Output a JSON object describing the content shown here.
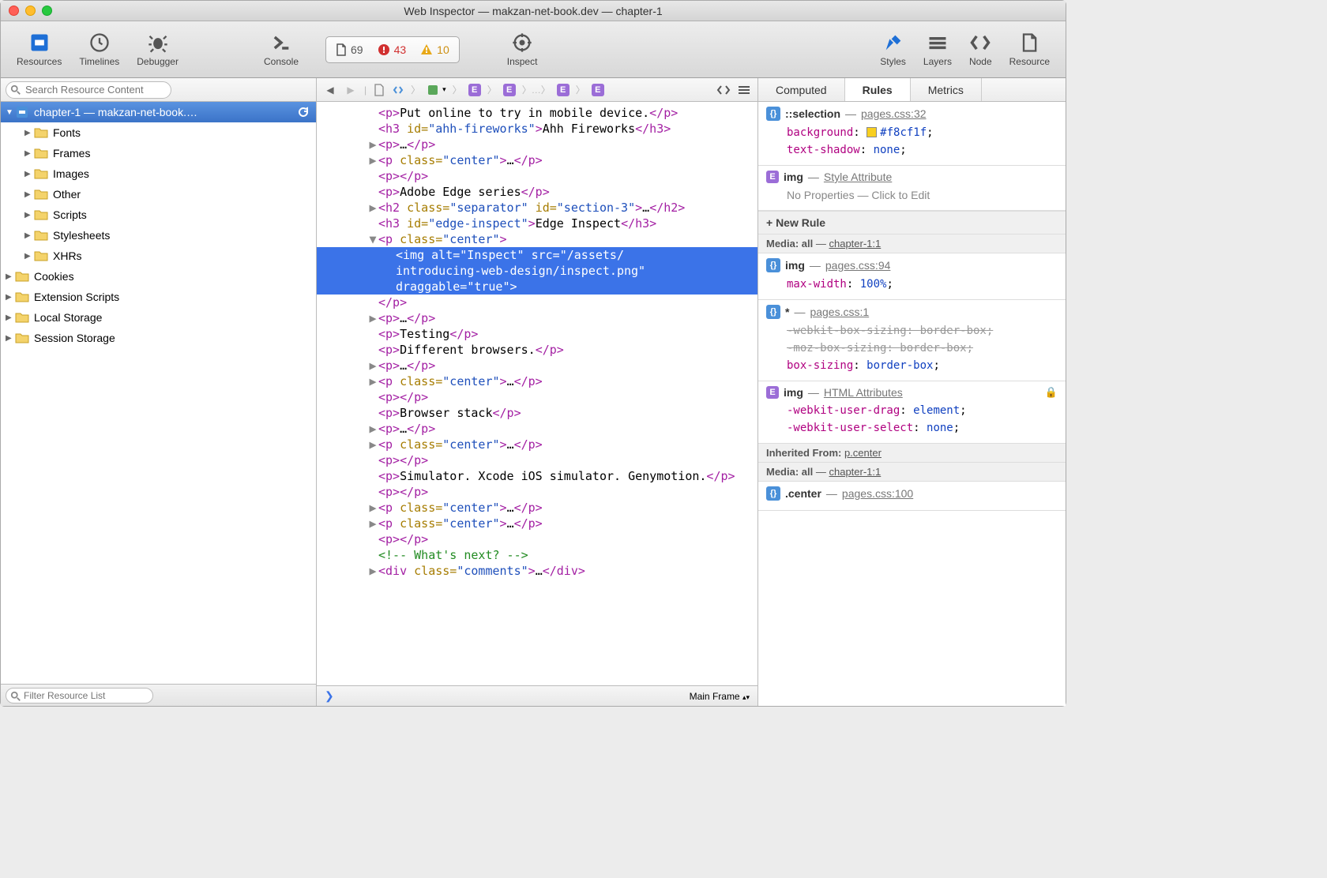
{
  "window": {
    "title": "Web Inspector — makzan-net-book.dev — chapter-1"
  },
  "toolbar": {
    "items": [
      {
        "label": "Resources"
      },
      {
        "label": "Timelines"
      },
      {
        "label": "Debugger"
      },
      {
        "label": "Console"
      },
      {
        "label": "Inspect"
      },
      {
        "label": "Styles"
      },
      {
        "label": "Layers"
      },
      {
        "label": "Node"
      },
      {
        "label": "Resource"
      }
    ],
    "status": {
      "resources": "69",
      "errors": "43",
      "warnings": "10"
    }
  },
  "sidebar": {
    "search_placeholder": "Search Resource Content",
    "filter_placeholder": "Filter Resource List",
    "root": "chapter-1 — makzan-net-book.…",
    "folders": [
      "Fonts",
      "Frames",
      "Images",
      "Other",
      "Scripts",
      "Stylesheets",
      "XHRs"
    ],
    "top": [
      "Cookies",
      "Extension Scripts",
      "Local Storage",
      "Session Storage"
    ]
  },
  "dom": {
    "lines": [
      {
        "html": "<span class='tag'>&lt;p&gt;</span><span class='text'>Put online to try in mobile device.</span><span class='tag'>&lt;/p&gt;</span>"
      },
      {
        "html": "<span class='tag'>&lt;h3 </span><span class='attr'>id=</span><span class='val'>\"ahh-fireworks\"</span><span class='tag'>&gt;</span><span class='text'>Ahh Fireworks</span><span class='tag'>&lt;/h3&gt;</span>"
      },
      {
        "tw": "▶",
        "html": "<span class='tag'>&lt;p&gt;</span>…<span class='tag'>&lt;/p&gt;</span>"
      },
      {
        "tw": "▶",
        "html": "<span class='tag'>&lt;p </span><span class='attr'>class=</span><span class='val'>\"center\"</span><span class='tag'>&gt;</span>…<span class='tag'>&lt;/p&gt;</span>"
      },
      {
        "html": "<span class='tag'>&lt;p&gt;&lt;/p&gt;</span>"
      },
      {
        "html": "<span class='tag'>&lt;p&gt;</span><span class='text'>Adobe Edge series</span><span class='tag'>&lt;/p&gt;</span>"
      },
      {
        "tw": "▶",
        "html": "<span class='tag'>&lt;h2 </span><span class='attr'>class=</span><span class='val'>\"separator\"</span> <span class='attr'>id=</span><span class='val'>\"section-3\"</span><span class='tag'>&gt;</span>…<span class='tag'>&lt;/h2&gt;</span>"
      },
      {
        "html": "<span class='tag'>&lt;h3 </span><span class='attr'>id=</span><span class='val'>\"edge-inspect\"</span><span class='tag'>&gt;</span><span class='text'>Edge Inspect</span><span class='tag'>&lt;/h3&gt;</span>"
      },
      {
        "tw": "▼",
        "html": "<span class='tag'>&lt;p </span><span class='attr'>class=</span><span class='val'>\"center\"</span><span class='tag'>&gt;</span>"
      },
      {
        "sel": true,
        "indent": true,
        "html": "<span class='tag'>&lt;img </span><span class='attr'>alt=</span><span class='val'>\"Inspect\"</span> <span class='attr'>src=</span><span class='val'>\"/assets/introducing-web-design/inspect.png\"</span> <span class='attr'>draggable=</span><span class='val'>\"true\"</span><span class='tag'>&gt;</span>"
      },
      {
        "html": "<span class='tag'>&lt;/p&gt;</span>"
      },
      {
        "tw": "▶",
        "html": "<span class='tag'>&lt;p&gt;</span>…<span class='tag'>&lt;/p&gt;</span>"
      },
      {
        "html": "<span class='tag'>&lt;p&gt;</span><span class='text'>Testing</span><span class='tag'>&lt;/p&gt;</span>"
      },
      {
        "html": "<span class='tag'>&lt;p&gt;</span><span class='text'>Different browsers.</span><span class='tag'>&lt;/p&gt;</span>"
      },
      {
        "tw": "▶",
        "html": "<span class='tag'>&lt;p&gt;</span>…<span class='tag'>&lt;/p&gt;</span>"
      },
      {
        "tw": "▶",
        "html": "<span class='tag'>&lt;p </span><span class='attr'>class=</span><span class='val'>\"center\"</span><span class='tag'>&gt;</span>…<span class='tag'>&lt;/p&gt;</span>"
      },
      {
        "html": "<span class='tag'>&lt;p&gt;&lt;/p&gt;</span>"
      },
      {
        "html": "<span class='tag'>&lt;p&gt;</span><span class='text'>Browser stack</span><span class='tag'>&lt;/p&gt;</span>"
      },
      {
        "tw": "▶",
        "html": "<span class='tag'>&lt;p&gt;</span>…<span class='tag'>&lt;/p&gt;</span>"
      },
      {
        "tw": "▶",
        "html": "<span class='tag'>&lt;p </span><span class='attr'>class=</span><span class='val'>\"center\"</span><span class='tag'>&gt;</span>…<span class='tag'>&lt;/p&gt;</span>"
      },
      {
        "html": "<span class='tag'>&lt;p&gt;&lt;/p&gt;</span>"
      },
      {
        "html": "<span class='tag'>&lt;p&gt;</span><span class='text'>Simulator. Xcode iOS simulator. Genymotion.</span><span class='tag'>&lt;/p&gt;</span>"
      },
      {
        "html": "<span class='tag'>&lt;p&gt;&lt;/p&gt;</span>"
      },
      {
        "tw": "▶",
        "html": "<span class='tag'>&lt;p </span><span class='attr'>class=</span><span class='val'>\"center\"</span><span class='tag'>&gt;</span>…<span class='tag'>&lt;/p&gt;</span>"
      },
      {
        "tw": "▶",
        "html": "<span class='tag'>&lt;p </span><span class='attr'>class=</span><span class='val'>\"center\"</span><span class='tag'>&gt;</span>…<span class='tag'>&lt;/p&gt;</span>"
      },
      {
        "html": "<span class='tag'>&lt;p&gt;&lt;/p&gt;</span>"
      },
      {
        "html": "<span class='cmt'>&lt;!-- What's next? --&gt;</span>"
      },
      {
        "tw": "▶",
        "html": "<span class='tag'>&lt;div </span><span class='attr'>class=</span><span class='val'>\"comments\"</span><span class='tag'>&gt;</span>…<span class='tag'>&lt;/div&gt;</span>"
      }
    ],
    "frame": "Main Frame"
  },
  "rtabs": [
    "Computed",
    "Rules",
    "Metrics"
  ],
  "rules": {
    "blocks": [
      {
        "badge": "css",
        "sel": "::selection",
        "src": "pages.css:32",
        "props": [
          {
            "n": "background",
            "v": "#f8cf1f",
            "swatch": "#f8cf1f"
          },
          {
            "n": "text-shadow",
            "v": "none"
          }
        ]
      },
      {
        "badge": "E",
        "sel": "img",
        "src": "Style Attribute",
        "plain": true,
        "empty": "No Properties — Click to Edit"
      },
      {
        "section": "+ New Rule"
      },
      {
        "media": "Media: all — chapter-1:1"
      },
      {
        "badge": "css",
        "sel": "img",
        "src": "pages.css:94",
        "props": [
          {
            "n": "max-width",
            "v": "100%"
          }
        ]
      },
      {
        "badge": "css",
        "sel": "*",
        "src": "pages.css:1",
        "props": [
          {
            "n": "-webkit-box-sizing",
            "v": "border-box",
            "strike": true
          },
          {
            "n": "-moz-box-sizing",
            "v": "border-box",
            "strike": true
          },
          {
            "n": "box-sizing",
            "v": "border-box"
          }
        ]
      },
      {
        "badge": "E",
        "sel": "img",
        "src": "HTML Attributes",
        "plain": true,
        "lock": true,
        "props": [
          {
            "n": "-webkit-user-drag",
            "v": "element"
          },
          {
            "n": "-webkit-user-select",
            "v": "none"
          }
        ]
      },
      {
        "inherit": "Inherited From: p.center"
      },
      {
        "media": "Media: all — chapter-1:1"
      },
      {
        "badge": "css",
        "sel": ".center",
        "src": "pages.css:100",
        "props": []
      }
    ]
  }
}
